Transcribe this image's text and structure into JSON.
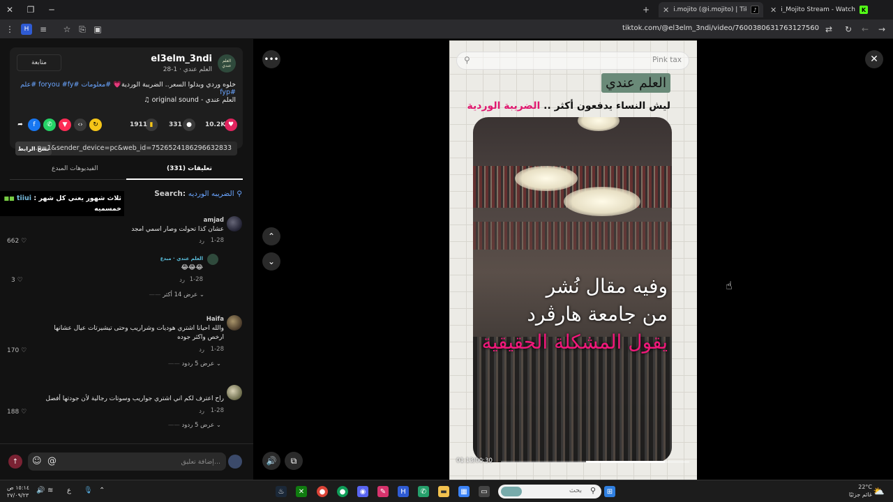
{
  "browser": {
    "tabs": [
      {
        "label": "i.mojito (@i.mojito) | TikTok",
        "active": true
      },
      {
        "label": "i_Mojito Stream - Watch Liv",
        "active": false
      }
    ],
    "new_tab_label": "+",
    "url": "tiktok.com/@el3elm_3ndi/video/7600380631763127560"
  },
  "video_info": {
    "author_avatar_text": "العلم عندي",
    "author": "el3elm_3ndi",
    "author_sub": "العلم عندي · 1-28",
    "follow_label": "متابعة",
    "caption_text": "خلوه وردي وبدلوا السعر.. الضريبة الوردية💗",
    "caption_tags": "#معلومات #foryou #fy #علم #fyp",
    "music": "♫ original sound - العلم عندي",
    "likes": "10.2K",
    "comments": "331",
    "saves": "1911",
    "copy_label": "نسخ الرابط",
    "share_url": "...p=1&sender_device=pc&web_id=7526524186296632833"
  },
  "panel_tabs": {
    "comments": "تعليقات (331)",
    "creator_videos": "الفيديوهات المبدع"
  },
  "search": {
    "label": "Search:",
    "query": "الضريبه الورديه"
  },
  "overlay_note": {
    "line1": "ثلاث شهور يعني كل شهر :",
    "highlight": "tiiui",
    "line2": "خمسميه"
  },
  "comments": [
    {
      "name": "amjad",
      "text": "عشان كذا تحولت وصار اسمي امجد",
      "date": "1-28",
      "reply": "رد",
      "likes": "662"
    },
    {
      "name": "العلم عندي · مبدع",
      "text": "😂😂😂",
      "date": "1-28",
      "reply": "رد",
      "likes": "3",
      "more": "عرض 14 أكثر"
    },
    {
      "name": "Haifa",
      "text": "والله احيانا اشتري هوديات وشراريب وحتى تيشيرتات عيال عشانها ارخص واكثر جوده",
      "date": "1-28",
      "reply": "رد",
      "likes": "170",
      "more": "عرض 5 ردود"
    },
    {
      "name": "",
      "text": "راح اعترف لكم اني اشتري جواريب وسوتات رجالية لأن جودتها أفضل",
      "date": "1-28",
      "reply": "رد",
      "likes": "188",
      "more": "عرض 5 ردود"
    }
  ],
  "add_comment": {
    "placeholder": "إضافة تعليق..."
  },
  "video": {
    "search_text": "Pink tax",
    "brand": "العلم عندي",
    "headline_a": "ليش النساء يدفعون أكثر ..",
    "headline_pink": "الضريبة الوردية",
    "overlay_line1": "وفيه مقال نُشر",
    "overlay_line2": "من جامعة هارڤرد",
    "overlay_line3": "يقول المشكلة الحقيقية",
    "time": "01:13/00:30",
    "progress": 0.42
  },
  "taskbar": {
    "search_placeholder": "بحث",
    "temp": "22°C",
    "weather": "غائم جزئيًا",
    "time": "١٥:١٤ ص",
    "date": "٢٧/٠٩/٢٣",
    "lang": "ع"
  }
}
